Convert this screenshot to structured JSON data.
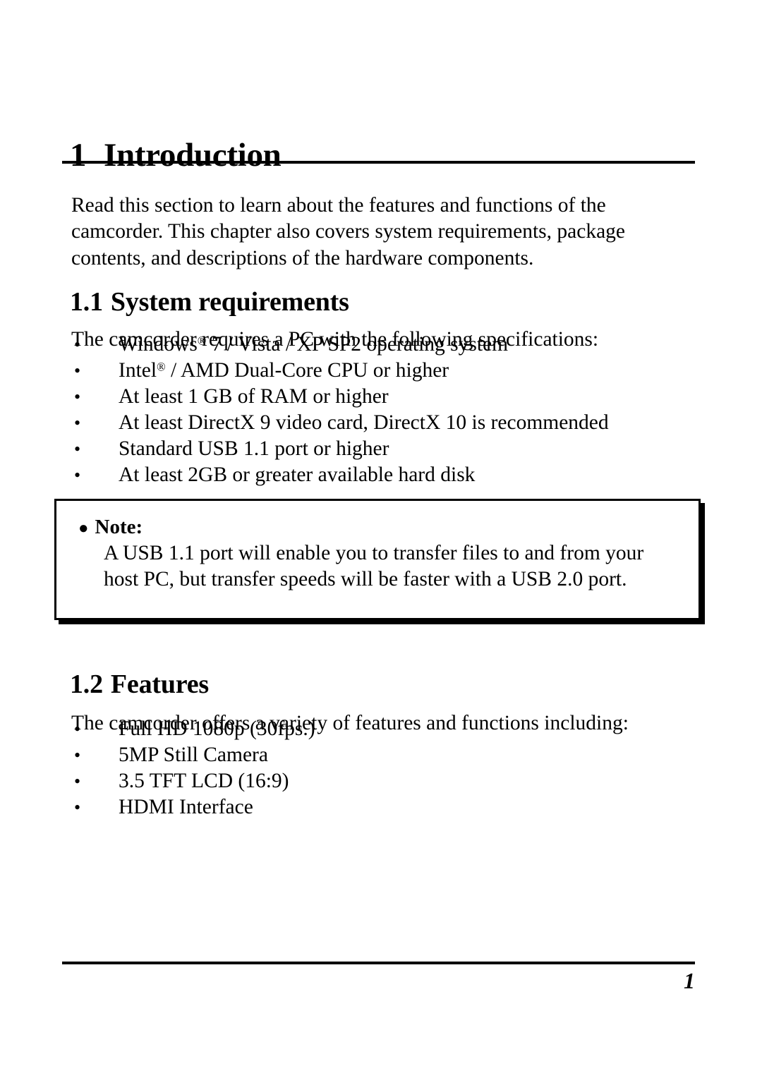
{
  "document": {
    "chapter": {
      "number": "1",
      "title": "Introduction",
      "intro": "Read this section to learn about the features and functions of the camcorder. This chapter also covers system requirements, package contents, and descriptions of the hardware components."
    },
    "sections": [
      {
        "number": "1.1",
        "title": "System requirements",
        "lead": "The camcorder requires a PC with the following specifications:",
        "bullets": [
          {
            "prefix": "Windows",
            "reg": "®",
            "suffix": " 7 / Vista / XP SP2 operating system"
          },
          {
            "prefix": "Intel",
            "reg": "®",
            "suffix": " / AMD Dual-Core CPU or higher"
          },
          {
            "prefix": "At least 1 GB of RAM or higher",
            "reg": "",
            "suffix": ""
          },
          {
            "prefix": "At least DirectX 9 video card, DirectX 10 is recommended",
            "reg": "",
            "suffix": ""
          },
          {
            "prefix": "Standard USB 1.1 port or higher",
            "reg": "",
            "suffix": ""
          },
          {
            "prefix": "At least 2GB or greater available hard disk",
            "reg": "",
            "suffix": ""
          }
        ]
      },
      {
        "number": "1.2",
        "title": "Features",
        "lead": "The camcorder offers a variety of features and functions including:",
        "bullets": [
          {
            "prefix": "Full HD 1080p (30fps.)",
            "reg": "",
            "suffix": ""
          },
          {
            "prefix": "5MP Still Camera",
            "reg": "",
            "suffix": ""
          },
          {
            "prefix": "3.5 TFT LCD (16:9)",
            "reg": "",
            "suffix": ""
          },
          {
            "prefix": "HDMI Interface",
            "reg": "",
            "suffix": ""
          }
        ]
      }
    ],
    "note": {
      "bullet": "●",
      "label": "Note:",
      "body": "A USB 1.1 port will enable you to transfer files to and from your host PC, but transfer speeds will be faster with a USB 2.0 port."
    },
    "footer": {
      "page_number": "1"
    },
    "bullet_glyph": "•",
    "colors": {
      "text": "#000000",
      "background": "#ffffff",
      "rule": "#000000"
    }
  }
}
